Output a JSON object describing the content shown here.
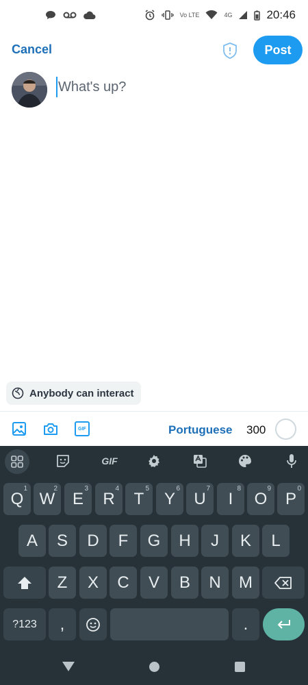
{
  "status_bar": {
    "time": "20:46",
    "volte": "Vo LTE",
    "network": "4G"
  },
  "header": {
    "cancel_label": "Cancel",
    "post_label": "Post"
  },
  "compose": {
    "placeholder": "What's up?"
  },
  "reply_settings": {
    "label": "Anybody can interact"
  },
  "toolbar": {
    "language": "Portuguese",
    "char_count": "300",
    "gif_label": "GIF"
  },
  "keyboard": {
    "toolbar": {
      "gif_label": "GIF"
    },
    "row1": [
      {
        "key": "Q",
        "hint": "1"
      },
      {
        "key": "W",
        "hint": "2"
      },
      {
        "key": "E",
        "hint": "3"
      },
      {
        "key": "R",
        "hint": "4"
      },
      {
        "key": "T",
        "hint": "5"
      },
      {
        "key": "Y",
        "hint": "6"
      },
      {
        "key": "U",
        "hint": "7"
      },
      {
        "key": "I",
        "hint": "8"
      },
      {
        "key": "O",
        "hint": "9"
      },
      {
        "key": "P",
        "hint": "0"
      }
    ],
    "row2": [
      "A",
      "S",
      "D",
      "F",
      "G",
      "H",
      "J",
      "K",
      "L"
    ],
    "row3": [
      "Z",
      "X",
      "C",
      "V",
      "B",
      "N",
      "M"
    ],
    "bottom": {
      "symbols_label": "?123",
      "comma_label": ",",
      "period_label": "."
    }
  },
  "colors": {
    "accent": "#1d9bf0",
    "keyboard_bg": "#263238",
    "key_bg": "#404d54",
    "enter_key": "#5fb3a4"
  }
}
